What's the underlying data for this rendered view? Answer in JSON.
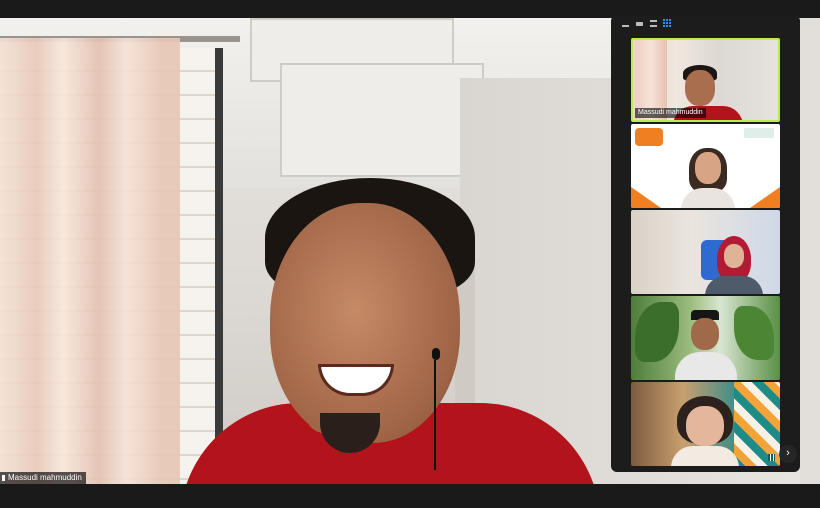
{
  "main_video": {
    "speaker_name": "Massudi mahmuddin"
  },
  "gallery": {
    "view_icons": [
      "minimize-icon",
      "strip-view-icon",
      "speaker-view-icon",
      "grid-view-icon"
    ],
    "tiles": [
      {
        "name": "Massudi mahmuddin",
        "active": true
      },
      {
        "name": "",
        "active": false
      },
      {
        "name": "",
        "active": false
      },
      {
        "name": "",
        "active": false
      },
      {
        "name": "",
        "active": false
      }
    ],
    "next_page_glyph": "›"
  },
  "colors": {
    "active_speaker_border": "#b8ee4a",
    "grid_icon_accent": "#2d8cff",
    "panel_bg": "#1c1c1c"
  }
}
